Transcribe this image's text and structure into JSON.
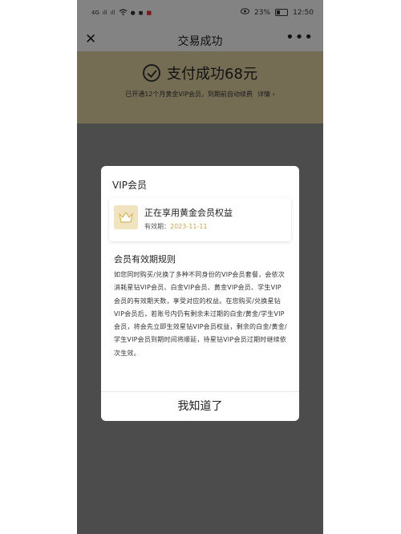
{
  "statusbar": {
    "left_items": [
      "4G",
      "ıll",
      "ıll",
      "wifi",
      "●",
      "◼",
      "■"
    ],
    "battery_percent": "23%",
    "time": "12:50"
  },
  "navbar": {
    "close_label": "✕",
    "title": "交易成功",
    "more_label": "•••"
  },
  "payment": {
    "title": "支付成功68元",
    "vip_opened": "已开通12个月黄金VIP会员，到期前自动续费",
    "detail_label": "详情 ›"
  },
  "modal": {
    "title": "VIP会员",
    "card": {
      "title": "正在享用黄金会员权益",
      "valid_label": "有效期：",
      "valid_date": "2023-11-11"
    },
    "rule_title": "会员有效期规则",
    "rule_text": "如您同时购买/兑换了多种不同身份的VIP会员套餐，会依次消耗星钻VIP会员、白金VIP会员、黄金VIP会员、学生VIP会员的有效期天数，享受对应的权益。在您购买/兑换星钻VIP会员后，若账号内仍有剩余未过期的白金/黄金/学生VIP会员，将会先立即生效星钻VIP会员权益，剩余的白金/黄金/学生VIP会员到期时间将顺延，待星钻VIP会员过期时继续依次生效。",
    "confirm_label": "我知道了"
  },
  "colors": {
    "gold_banner": "#d6c59a",
    "valid_date": "#c9a64f",
    "crown": "#f1e3c0"
  }
}
